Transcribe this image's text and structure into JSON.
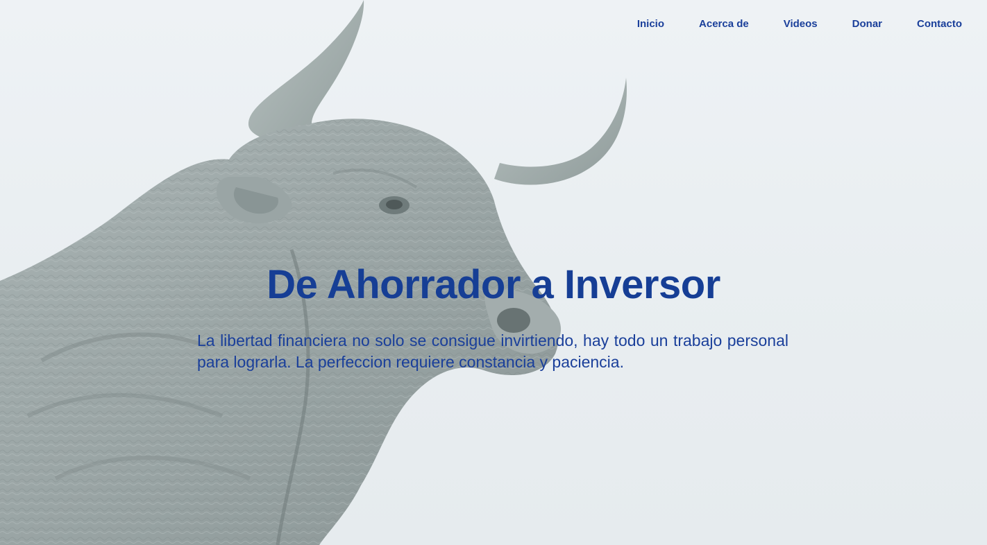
{
  "nav": {
    "items": [
      {
        "label": "Inicio"
      },
      {
        "label": "Acerca de"
      },
      {
        "label": "Videos"
      },
      {
        "label": "Donar"
      },
      {
        "label": "Contacto"
      }
    ]
  },
  "hero": {
    "title": "De Ahorrador a Inversor",
    "text": "La libertad financiera no solo se consigue invirtiendo, hay todo un trabajo personal para lograrla. La perfeccion requiere constancia y paciencia."
  },
  "colors": {
    "accent": "#1a3f9a",
    "background": "#eef2f5",
    "image_tone": "#98a3a3"
  },
  "icons": {
    "hero_image": "bull-illustration"
  }
}
